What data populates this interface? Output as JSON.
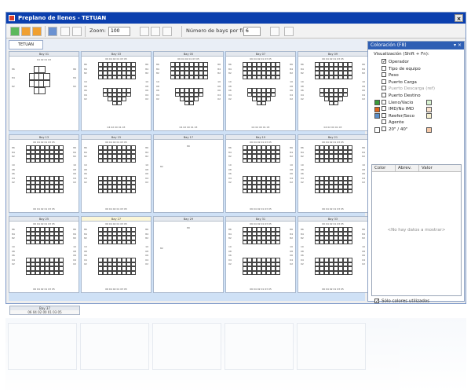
{
  "window": {
    "title": "Preplano de llenos - TETUAN",
    "close_glyph": "×"
  },
  "toolbar": {
    "zoom_label": "Zoom:",
    "zoom_value": "100",
    "bays_per_row_label": "Número de bays por fila:",
    "bays_per_row_value": "6"
  },
  "tab": {
    "label": "TETUAN"
  },
  "bays": [
    {
      "title": "Bay 01"
    },
    {
      "title": "Bay 03"
    },
    {
      "title": "Bay 05"
    },
    {
      "title": "Bay 07"
    },
    {
      "title": "Bay 09"
    },
    {
      "title": "Bay 13"
    },
    {
      "title": "Bay 15"
    },
    {
      "title": "Bay 17"
    },
    {
      "title": "Bay 19"
    },
    {
      "title": "Bay 21"
    },
    {
      "title": "Bay 25"
    },
    {
      "title": "Bay 27"
    },
    {
      "title": "Bay 29"
    },
    {
      "title": "Bay 31"
    },
    {
      "title": "Bay 33"
    },
    {
      "title": "Bay 37"
    }
  ],
  "bay_labels": {
    "top_row": "06 04 02 01 03 05",
    "small_top": "04 02 01 03",
    "small_bottom": "04 02 00 01 03",
    "side_left": "86\n84\n82\n\n10\n08\n06\n04\n02",
    "side_right": "86\n84\n82\n\n10\n08\n06\n04\n02",
    "bay29_top": "80",
    "bay29_side": "82",
    "bay37_row": "06 04 02 00 01 03 05"
  },
  "panel": {
    "title": "Coloración (F8)",
    "visualization_label": "Visualización (Shift + Fn):",
    "options": [
      {
        "label": "Operador",
        "checked": true,
        "disabled": false
      },
      {
        "label": "Tipo de equipo",
        "checked": false,
        "disabled": false
      },
      {
        "label": "Peso",
        "checked": false,
        "disabled": false
      },
      {
        "label": "Puerto Carga",
        "checked": false,
        "disabled": false
      },
      {
        "label": "Puerto Descarga (ref)",
        "checked": false,
        "disabled": true
      },
      {
        "label": "Puerto Destino",
        "checked": false,
        "disabled": false
      },
      {
        "label": "Lleno/Vacio",
        "checked": false,
        "disabled": false
      },
      {
        "label": "IMD/No IMD",
        "checked": false,
        "disabled": false
      },
      {
        "label": "Reefer/Seco",
        "checked": false,
        "disabled": false
      },
      {
        "label": "Agente",
        "checked": false,
        "disabled": false
      },
      {
        "label": "20\" / 40\"",
        "checked": false,
        "disabled": false
      }
    ],
    "colors": {
      "lleno_left": "#3a9c3a",
      "lleno_right": "#d8f2d0",
      "imd_left": "#e0651b",
      "imd_right": "#fbe2cc",
      "reefer_left": "#5a8ec8",
      "reefer_right": "#f6f0d0",
      "size_left": "#ffffff",
      "size_right": "#f6c9a8"
    },
    "table": {
      "col_color": "Color",
      "col_abbr": "Abrev.",
      "col_value": "Valor",
      "empty_message": "<No hay datos a mostrar>"
    },
    "only_used_label": "Sólo colores utilizados",
    "only_used_checked": "✓"
  },
  "bottom_tab": {
    "title": "Bay 37",
    "row": "06 04 02 00 01 03 05"
  }
}
